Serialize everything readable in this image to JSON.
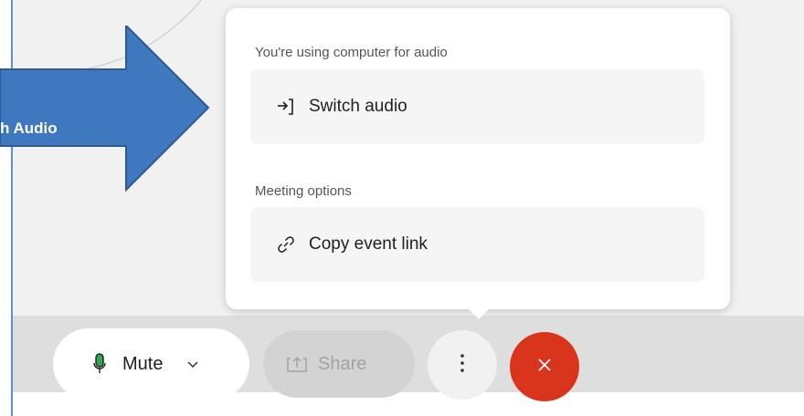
{
  "callout": {
    "label": "h Audio",
    "fill": "#3f78bf",
    "stroke": "#2d5a91"
  },
  "menu": {
    "audio_header": "You're using computer for audio",
    "switch_audio_label": "Switch audio",
    "switch_audio_icon": "switch-audio-icon",
    "meeting_header": "Meeting options",
    "copy_link_label": "Copy event link",
    "copy_link_icon": "link-icon"
  },
  "toolbar": {
    "mute_label": "Mute",
    "mute_icon": "microphone-icon",
    "mic_color": "#2fa84f",
    "share_label": "Share",
    "share_icon": "share-icon",
    "more_icon": "more-vertical-icon",
    "end_icon": "close-icon",
    "end_color": "#d8351c"
  }
}
